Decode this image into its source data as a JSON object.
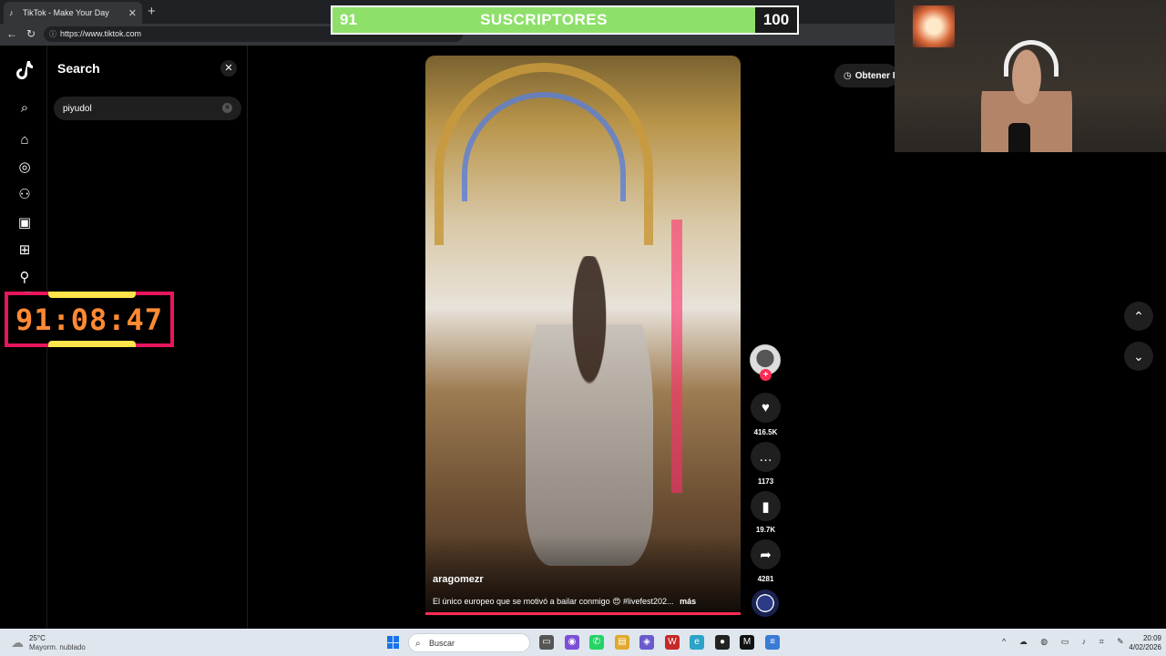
{
  "browser": {
    "tab_title": "TikTok - Make Your Day",
    "tab_close": "✕",
    "new_tab": "+",
    "back": "←",
    "reload": "↻",
    "url": "https://www.tiktok.com"
  },
  "subscriber_goal": {
    "current": "91",
    "label": "SUSCRIPTORES",
    "goal": "100",
    "progress_fraction": 0.91,
    "fill_color": "#8ee06a"
  },
  "sidebar": {
    "logo_icon": "tiktok-logo",
    "items": [
      {
        "icon": "search-icon",
        "glyph": "⌕"
      },
      {
        "icon": "home-icon",
        "glyph": "⌂"
      },
      {
        "icon": "explore-icon",
        "glyph": "◎"
      },
      {
        "icon": "following-icon",
        "glyph": "⚇"
      },
      {
        "icon": "live-icon",
        "glyph": "▣"
      },
      {
        "icon": "upload-icon",
        "glyph": "⊞"
      },
      {
        "icon": "profile-icon",
        "glyph": "⚲"
      }
    ]
  },
  "search_panel": {
    "title": "Search",
    "close": "✕",
    "query": "piyudol",
    "clear": "✕"
  },
  "timer": {
    "text": "91:08:47",
    "more": "...",
    "border_color": "#e8155f",
    "digit_color": "#ff8a33"
  },
  "video": {
    "username": "aragomezr",
    "caption": "El único europeo que se motivó a bailar conmigo 😍 #livefest202...",
    "more": "más",
    "progress_fraction": 1.0
  },
  "actions": {
    "follow": "+",
    "likes": "416.5K",
    "comments": "1173",
    "saves": "19.7K",
    "shares": "4281"
  },
  "get_app": "Obtener I",
  "taskbar": {
    "temperature": "25°C",
    "weather": "Mayorm. nublado",
    "search_label": "Buscar",
    "time": "20:09",
    "date": "4/02/2026"
  },
  "colors": {
    "tiktok_red": "#fe2c55",
    "accent_blue": "#1a73e8"
  }
}
